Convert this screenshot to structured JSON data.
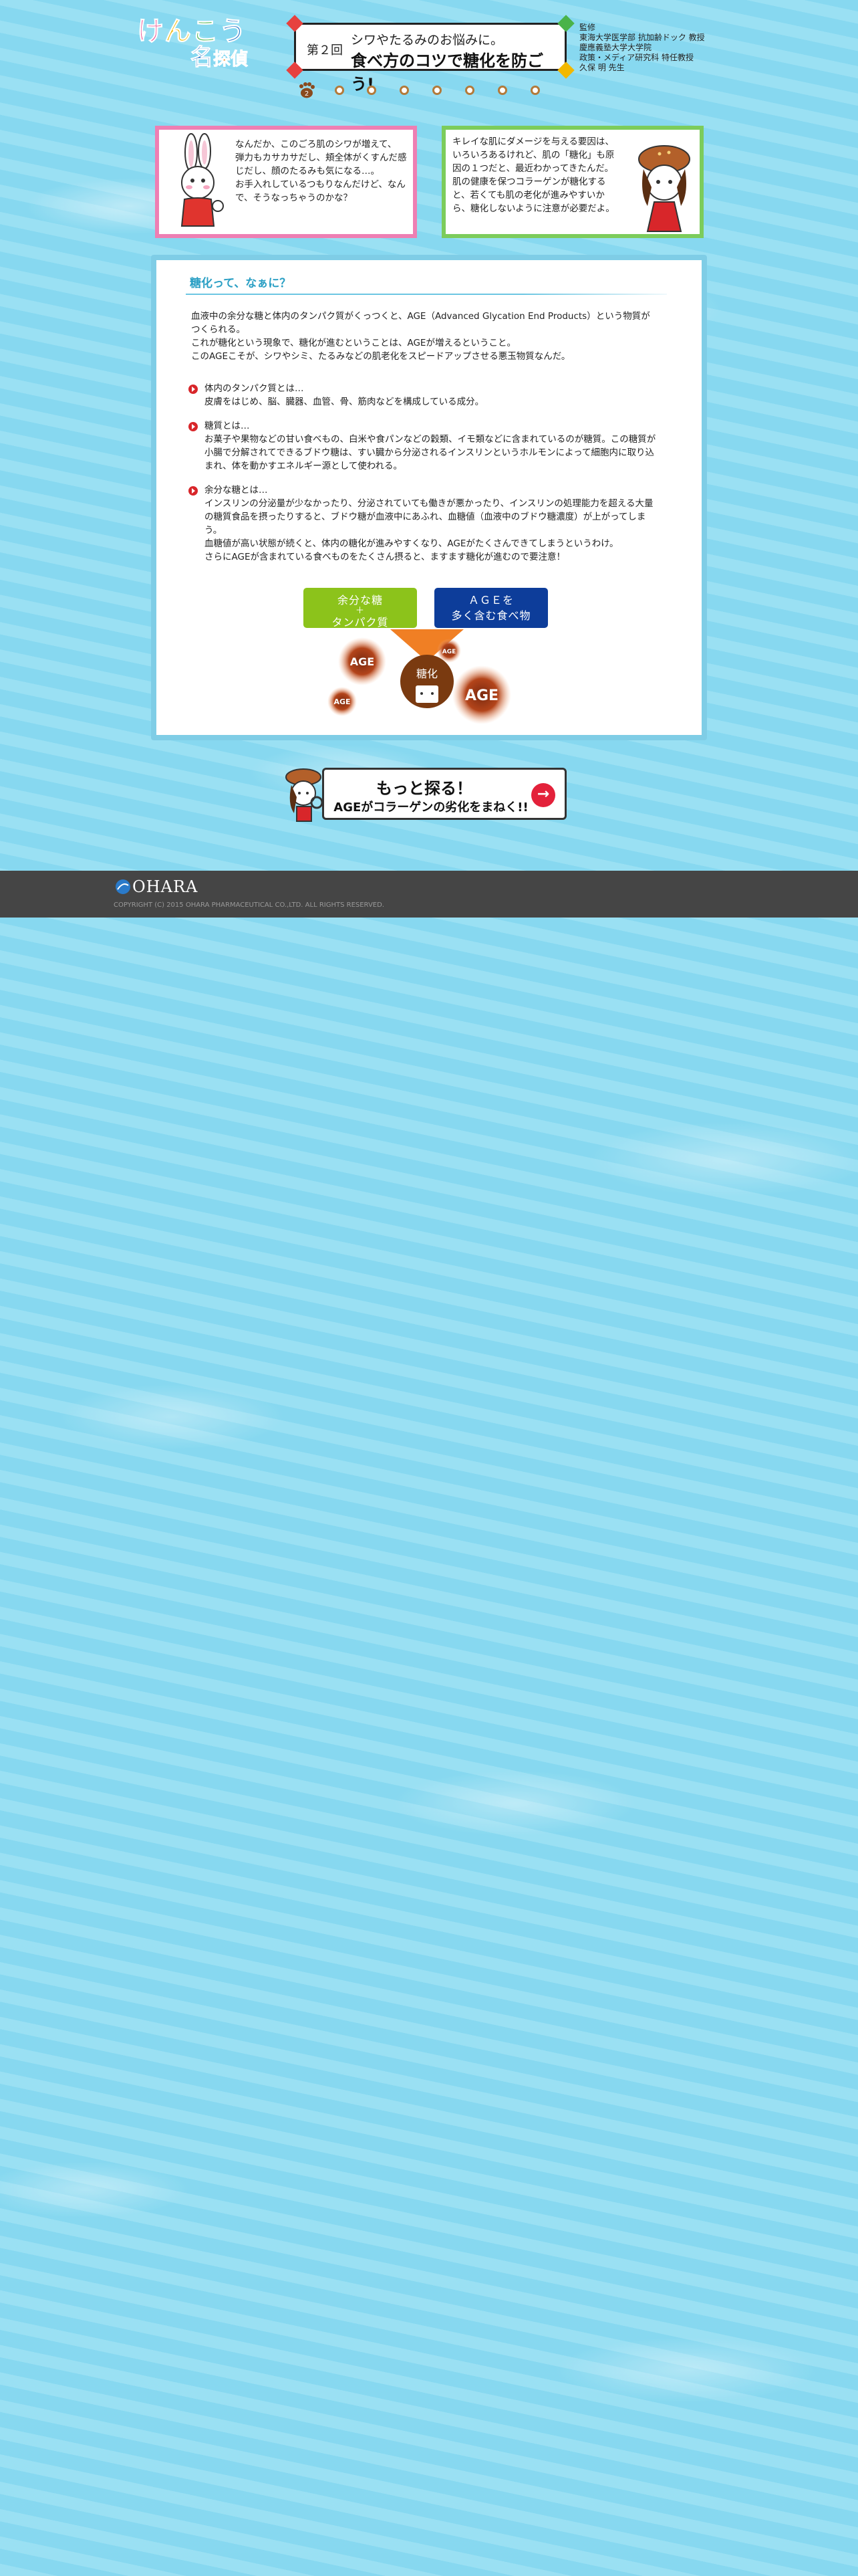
{
  "header": {
    "logo_line1": [
      "け",
      "ん",
      "こ",
      "う"
    ],
    "logo_line2": [
      "名",
      "探",
      "偵"
    ],
    "episode": "第２回",
    "title_line1": "シワやたるみのお悩みに。",
    "title_line2": "食べ方のコツで糖化を防ごう!",
    "supervisor": {
      "label": "監修",
      "affiliation1": "東海大学医学部 抗加齢ドック 教授",
      "affiliation2": "慶應義塾大学大学院",
      "affiliation3": "政策・メディア研究科 特任教授",
      "name": "久保 明 先生"
    },
    "current_page": "2"
  },
  "speech": {
    "left": "なんだか、このごろ肌のシワが増えて、\n弾力もカサカサだし、頬全体がくすんだ感\nじだし、顔のたるみも気になる…。\nお手入れしているつもりなんだけど、なん\nで、そうなっちゃうのかな？",
    "right": "キレイな肌にダメージを与える要因は、\nいろいろあるけれど、肌の「糖化」も原\n因の１つだと、最近わかってきたんだ。\n肌の健康を保つコラーゲンが糖化する\nと、若くても肌の老化が進みやすいか\nら、糖化しないように注意が必要だよ。"
  },
  "main": {
    "section_title": "糖化って、なぁに？",
    "intro": "血液中の余分な糖と体内のタンパク質がくっつくと、AGE（Advanced Glycation End Products）という物質が\nつくられる。\nこれが糖化という現象で、糖化が進むということは、AGEが増えるということ。\nこのAGEこそが、シワやシミ、たるみなどの肌老化をスピードアップさせる悪玉物質なんだ。",
    "bullets": [
      {
        "head": "体内のタンパク質とは…",
        "body": "皮膚をはじめ、脳、臓器、血管、骨、筋肉などを構成している成分。"
      },
      {
        "head": "糖質とは…",
        "body": "お菓子や果物などの甘い食べもの、白米や食パンなどの穀類、イモ類などに含まれているのが糖質。この糖質が\n小腸で分解されてできるブドウ糖は、すい臓から分泌されるインスリンというホルモンによって細胞内に取り込\nまれ、体を動かすエネルギー源として使われる。"
      },
      {
        "head": "余分な糖とは…",
        "body": "インスリンの分泌量が少なかったり、分泌されていても働きが悪かったり、インスリンの処理能力を超える大量\nの糖質食品を摂ったりすると、ブドウ糖が血液中にあふれ、血糖値（血液中のブドウ糖濃度）が上がってしま\nう。\n血糖値が高い状態が続くと、体内の糖化が進みやすくなり、AGEがたくさんできてしまうというわけ。\nさらにAGEが含まれている食べものをたくさん摂ると、ますます糖化が進むので要注意！"
      }
    ],
    "box_green": [
      "余分な糖",
      "＋",
      "タンパク質"
    ],
    "box_blue": [
      "ＡＧＥを",
      "多く含む食べ物"
    ],
    "diagram_center": "糖化",
    "age_label": "AGE"
  },
  "banner": {
    "line1": "もっと探る！",
    "line2": "AGEがコラーゲンの劣化をまねく!!"
  },
  "footer": {
    "brand": "OHARA",
    "copyright": "COPYRIGHT (C) 2015 OHARA PHARMACEUTICAL CO.,LTD. ALL RIGHTS RESERVED."
  },
  "colors": {
    "background": "#8fdcf2",
    "pink_border": "#ee7fb3",
    "green_border": "#7ccc5b",
    "panel_border": "#7fcde6",
    "accent_title": "#2a9fc4",
    "box_green": "#8cc31b",
    "box_blue": "#0d3d9a",
    "footer": "#454545"
  }
}
